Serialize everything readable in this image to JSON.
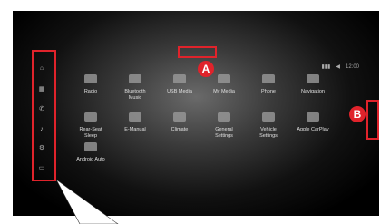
{
  "status_bar": {
    "items": [
      "▮▮▮",
      "◀",
      "12:00"
    ]
  },
  "sidebar": {
    "icons": [
      {
        "name": "home-icon",
        "glyph": "⌂"
      },
      {
        "name": "apps-icon",
        "glyph": "▦"
      },
      {
        "name": "phone-icon",
        "glyph": "✆"
      },
      {
        "name": "music-icon",
        "glyph": "♪"
      },
      {
        "name": "settings-icon",
        "glyph": "⚙"
      },
      {
        "name": "vehicle-icon",
        "glyph": "▭"
      }
    ]
  },
  "apps": [
    {
      "label": "Radio",
      "icon": "radio-icon"
    },
    {
      "label": "Bluetooth\nMusic",
      "icon": "bluetooth-music-icon"
    },
    {
      "label": "USB Media",
      "icon": "usb-media-icon"
    },
    {
      "label": "My Media",
      "icon": "my-media-icon"
    },
    {
      "label": "Phone",
      "icon": "phone-icon"
    },
    {
      "label": "Navigation",
      "icon": "navigation-icon"
    },
    {
      "label": "Rear-Seat\nSleep",
      "icon": "rear-seat-sleep-icon"
    },
    {
      "label": "E-Manual",
      "icon": "e-manual-icon"
    },
    {
      "label": "Climate",
      "icon": "climate-icon"
    },
    {
      "label": "General\nSettings",
      "icon": "general-settings-icon"
    },
    {
      "label": "Vehicle\nSettings",
      "icon": "vehicle-settings-icon"
    },
    {
      "label": "Apple CarPlay",
      "icon": "apple-carplay-icon"
    },
    {
      "label": "Android Auto",
      "icon": "android-auto-icon"
    }
  ],
  "markers": {
    "a": "A",
    "b": "B"
  },
  "colors": {
    "highlight": "#e0232b"
  }
}
